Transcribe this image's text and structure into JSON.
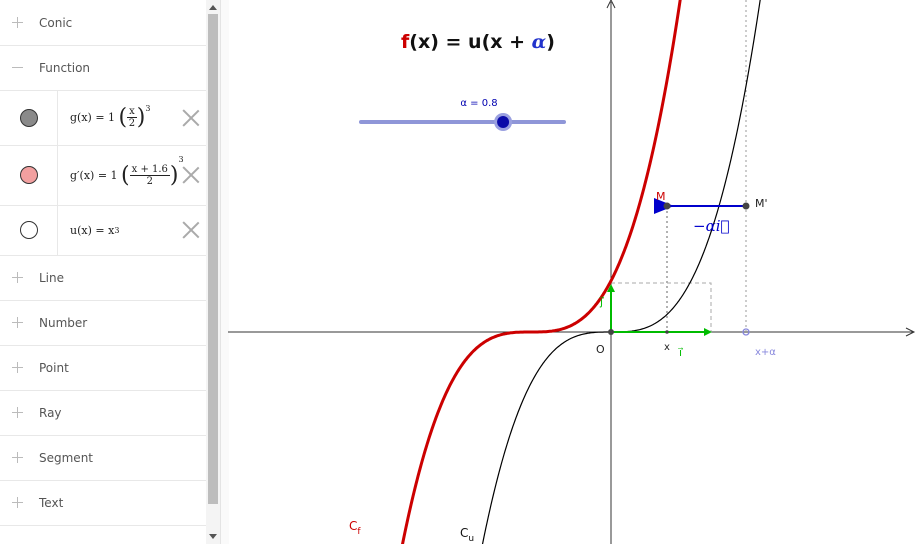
{
  "algebra": {
    "categories_top": [
      {
        "label": "Conic",
        "expanded": false
      },
      {
        "label": "Function",
        "expanded": true
      }
    ],
    "objects": [
      {
        "name": "g",
        "color": "#8a8a8a",
        "lhs": "g(x)",
        "eq": "=",
        "coef": "1",
        "num": "x",
        "den": "2",
        "exp": "3"
      },
      {
        "name": "g'",
        "color": "#f2a0a0",
        "lhs": "g′(x)",
        "eq": "=",
        "coef": "1",
        "num": "x + 1.6",
        "den": "2",
        "exp": "3"
      },
      {
        "name": "u",
        "color": "#ffffff",
        "lhs": "u(x)",
        "eq": "=",
        "rhs": "x",
        "exp": "3"
      }
    ],
    "categories_bottom": [
      {
        "label": "Line"
      },
      {
        "label": "Number"
      },
      {
        "label": "Point"
      },
      {
        "label": "Ray"
      },
      {
        "label": "Segment"
      },
      {
        "label": "Text"
      }
    ]
  },
  "graphics": {
    "title": {
      "f": "f",
      "mid": "(x) = u(x + ",
      "alpha": "α",
      "end": ")"
    },
    "slider": {
      "label": "α = 0.8",
      "value": 0.8,
      "min": -2,
      "max": 2,
      "color": "#0000b0"
    },
    "labels": {
      "M": "M",
      "Mp": "M'",
      "vec": "−αi⃗",
      "O": "O",
      "x": "x",
      "i": "i⃗",
      "j": "j⃗",
      "xa": "x+α",
      "Cf": "C",
      "Cf_sub": "f",
      "Cu": "C",
      "Cu_sub": "u"
    },
    "colors": {
      "f_curve": "#cc0000",
      "u_curve": "#000000",
      "vector": "#0000cc",
      "basis": "#00bb00",
      "alpha": "#2233cc",
      "point_xa": "#8888dd"
    }
  }
}
